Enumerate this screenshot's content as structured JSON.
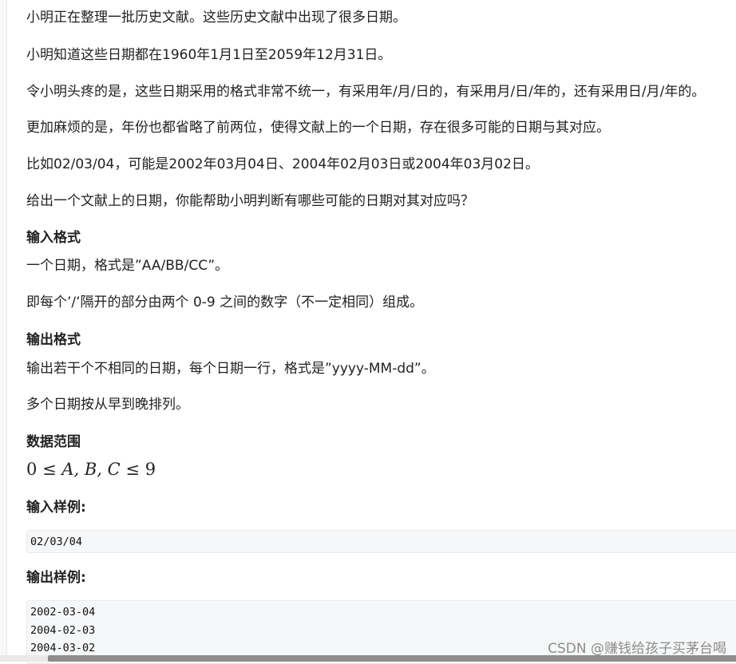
{
  "paragraphs": [
    "小明正在整理一批历史文献。这些历史文献中出现了很多日期。",
    "小明知道这些日期都在1960年1月1日至2059年12月31日。",
    "令小明头疼的是，这些日期采用的格式非常不统一，有采用年/月/日的，有采用月/日/年的，还有采用日/月/年的。",
    "更加麻烦的是，年份也都省略了前两位，使得文献上的一个日期，存在很多可能的日期与其对应。",
    "比如02/03/04，可能是2002年03月04日、2004年02月03日或2004年03月02日。",
    "给出一个文献上的日期，你能帮助小明判断有哪些可能的日期对其对应吗？"
  ],
  "input_format": {
    "heading": "输入格式",
    "lines": [
      "一个日期，格式是”AA/BB/CC”。",
      "即每个’/’隔开的部分由两个 0-9 之间的数字（不一定相同）组成。"
    ]
  },
  "output_format": {
    "heading": "输出格式",
    "lines": [
      "输出若干个不相同的日期，每个日期一行，格式是”yyyy-MM-dd”。",
      "多个日期按从早到晚排列。"
    ]
  },
  "data_range": {
    "heading": "数据范围",
    "math": {
      "lo": "0",
      "le": "≤",
      "vars": "A, B, C",
      "hi": "9"
    }
  },
  "sample_input": {
    "heading": "输入样例:",
    "lines": [
      "02/03/04"
    ]
  },
  "sample_output": {
    "heading": "输出样例:",
    "lines": [
      "2002-03-04",
      "2004-02-03",
      "2004-03-02"
    ]
  },
  "watermark": "CSDN @赚钱给孩子买茅台喝"
}
